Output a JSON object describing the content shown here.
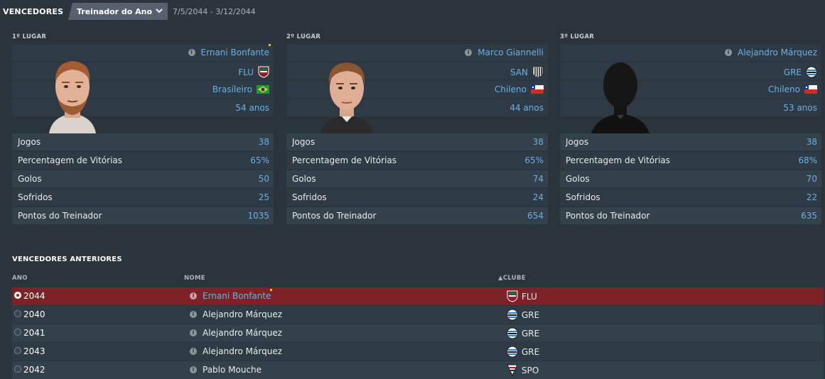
{
  "header": {
    "title": "VENCEDORES",
    "award_dropdown": "Treinador do Ano",
    "date_range": "7/5/2044 - 3/12/2044"
  },
  "podium": [
    {
      "place": "1º LUGAR",
      "name": "Ernani Bonfante",
      "club": "FLU",
      "nationality": "Brasileiro",
      "age": "54 anos",
      "stats": [
        {
          "label": "Jogos",
          "value": "38"
        },
        {
          "label": "Percentagem de Vitórias",
          "value": "65%"
        },
        {
          "label": "Golos",
          "value": "50"
        },
        {
          "label": "Sofridos",
          "value": "25"
        },
        {
          "label": "Pontos do Treinador",
          "value": "1035"
        }
      ]
    },
    {
      "place": "2º LUGAR",
      "name": "Marco Giannelli",
      "club": "SAN",
      "nationality": "Chileno",
      "age": "44 anos",
      "stats": [
        {
          "label": "Jogos",
          "value": "38"
        },
        {
          "label": "Percentagem de Vitórias",
          "value": "65%"
        },
        {
          "label": "Golos",
          "value": "74"
        },
        {
          "label": "Sofridos",
          "value": "24"
        },
        {
          "label": "Pontos do Treinador",
          "value": "654"
        }
      ]
    },
    {
      "place": "3º LUGAR",
      "name": "Alejandro Márquez",
      "club": "GRE",
      "nationality": "Chileno",
      "age": "53 anos",
      "stats": [
        {
          "label": "Jogos",
          "value": "38"
        },
        {
          "label": "Percentagem de Vitórias",
          "value": "68%"
        },
        {
          "label": "Golos",
          "value": "70"
        },
        {
          "label": "Sofridos",
          "value": "22"
        },
        {
          "label": "Pontos do Treinador",
          "value": "635"
        }
      ]
    }
  ],
  "previous": {
    "heading": "VENCEDORES ANTERIORES",
    "columns": {
      "year": "ANO",
      "name": "NOME",
      "club": "▲CLUBE"
    },
    "rows": [
      {
        "year": "2044",
        "name": "Ernani Bonfante",
        "club": "FLU"
      },
      {
        "year": "2040",
        "name": "Alejandro Márquez",
        "club": "GRE"
      },
      {
        "year": "2041",
        "name": "Alejandro Márquez",
        "club": "GRE"
      },
      {
        "year": "2043",
        "name": "Alejandro Márquez",
        "club": "GRE"
      },
      {
        "year": "2042",
        "name": "Pablo Mouche",
        "club": "SPO"
      }
    ]
  },
  "colors": {
    "background": "#2b353d",
    "panel": "#29343c",
    "accent_blue": "#6ab0e8",
    "selected_row": "#7d2327"
  }
}
